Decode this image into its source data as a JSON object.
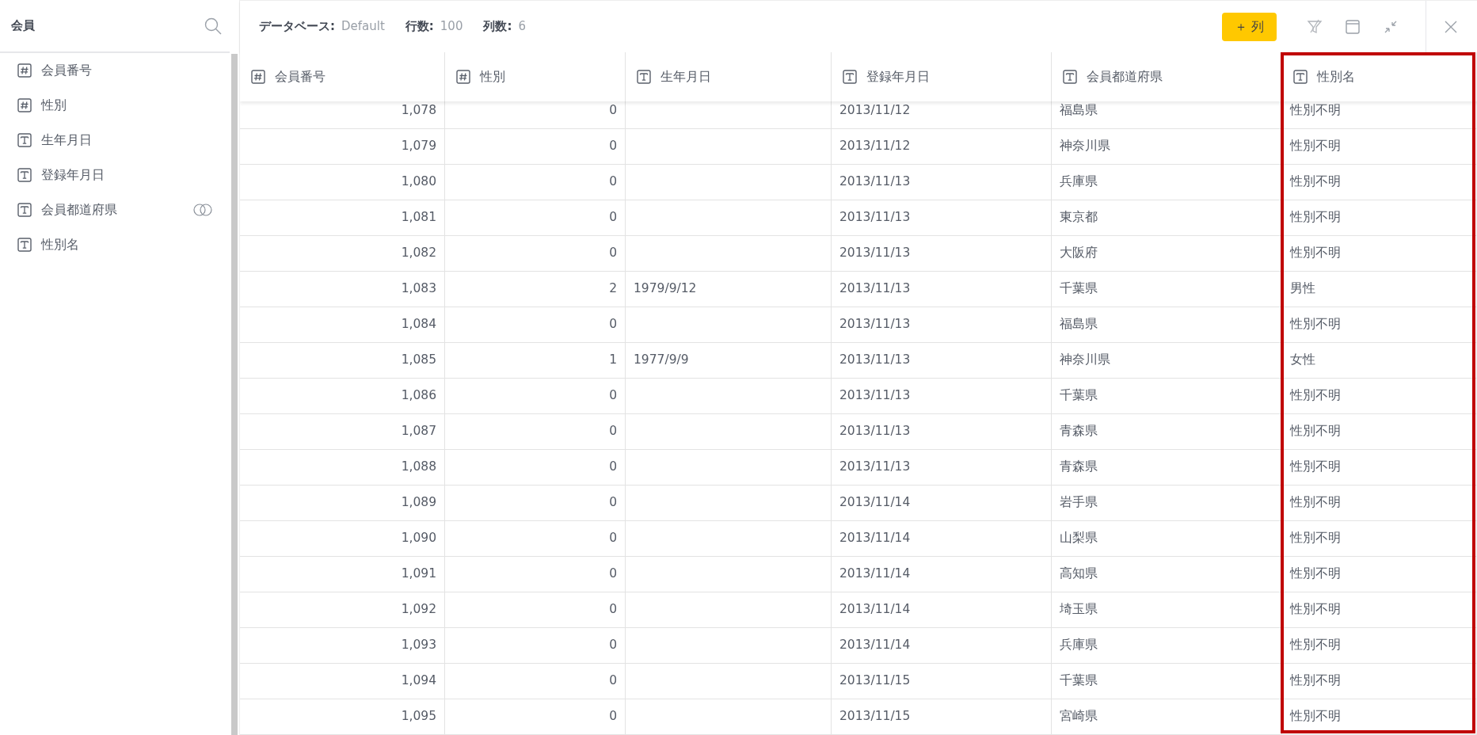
{
  "sidebar": {
    "title": "会員",
    "fields": [
      {
        "kind": "number",
        "label": "会員番号",
        "linked": false
      },
      {
        "kind": "number",
        "label": "性別",
        "linked": false
      },
      {
        "kind": "text",
        "label": "生年月日",
        "linked": false
      },
      {
        "kind": "text",
        "label": "登録年月日",
        "linked": false
      },
      {
        "kind": "text",
        "label": "会員都道府県",
        "linked": true
      },
      {
        "kind": "text",
        "label": "性別名",
        "linked": false
      }
    ]
  },
  "toolbar": {
    "stats": [
      {
        "label": "データベース:",
        "value": "Default"
      },
      {
        "label": "行数:",
        "value": "100"
      },
      {
        "label": "列数:",
        "value": "6"
      }
    ],
    "add_button": {
      "symbol": "＋",
      "label": "列"
    }
  },
  "table": {
    "columns": [
      {
        "kind": "number",
        "label": "会員番号",
        "highlighted": false
      },
      {
        "kind": "number",
        "label": "性別",
        "highlighted": false
      },
      {
        "kind": "text",
        "label": "生年月日",
        "highlighted": false
      },
      {
        "kind": "text",
        "label": "登録年月日",
        "highlighted": false
      },
      {
        "kind": "text",
        "label": "会員都道府県",
        "highlighted": false
      },
      {
        "kind": "text",
        "label": "性別名",
        "highlighted": true
      }
    ],
    "rows": [
      [
        "1,078",
        "0",
        null,
        "2013/11/12",
        "福島県",
        "性別不明"
      ],
      [
        "1,079",
        "0",
        null,
        "2013/11/12",
        "神奈川県",
        "性別不明"
      ],
      [
        "1,080",
        "0",
        null,
        "2013/11/13",
        "兵庫県",
        "性別不明"
      ],
      [
        "1,081",
        "0",
        null,
        "2013/11/13",
        "東京都",
        "性別不明"
      ],
      [
        "1,082",
        "0",
        null,
        "2013/11/13",
        "大阪府",
        "性別不明"
      ],
      [
        "1,083",
        "2",
        "1979/9/12",
        "2013/11/13",
        "千葉県",
        "男性"
      ],
      [
        "1,084",
        "0",
        null,
        "2013/11/13",
        "福島県",
        "性別不明"
      ],
      [
        "1,085",
        "1",
        "1977/9/9",
        "2013/11/13",
        "神奈川県",
        "女性"
      ],
      [
        "1,086",
        "0",
        null,
        "2013/11/13",
        "千葉県",
        "性別不明"
      ],
      [
        "1,087",
        "0",
        null,
        "2013/11/13",
        "青森県",
        "性別不明"
      ],
      [
        "1,088",
        "0",
        null,
        "2013/11/13",
        "青森県",
        "性別不明"
      ],
      [
        "1,089",
        "0",
        null,
        "2013/11/14",
        "岩手県",
        "性別不明"
      ],
      [
        "1,090",
        "0",
        null,
        "2013/11/14",
        "山梨県",
        "性別不明"
      ],
      [
        "1,091",
        "0",
        null,
        "2013/11/14",
        "高知県",
        "性別不明"
      ],
      [
        "1,092",
        "0",
        null,
        "2013/11/14",
        "埼玉県",
        "性別不明"
      ],
      [
        "1,093",
        "0",
        null,
        "2013/11/14",
        "兵庫県",
        "性別不明"
      ],
      [
        "1,094",
        "0",
        null,
        "2013/11/15",
        "千葉県",
        "性別不明"
      ],
      [
        "1,095",
        "0",
        null,
        "2013/11/15",
        "宮崎県",
        "性別不明"
      ]
    ]
  }
}
